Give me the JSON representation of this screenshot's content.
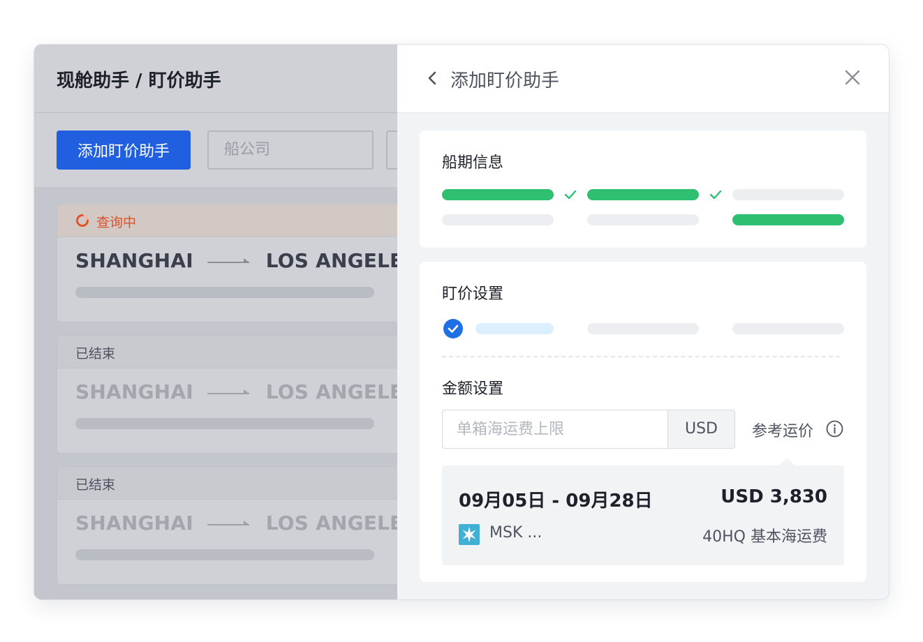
{
  "left": {
    "breadcrumb": "现舱助手 / 盯价助手",
    "add_button": "添加盯价助手",
    "carrier_placeholder": "船公司",
    "cards": [
      {
        "status": "查询中",
        "origin": "SHANGHAI",
        "destination": "LOS ANGELES",
        "active": true
      },
      {
        "status": "已结束",
        "origin": "SHANGHAI",
        "destination": "LOS ANGELES",
        "active": false
      },
      {
        "status": "已结束",
        "origin": "SHANGHAI",
        "destination": "LOS ANGELES",
        "active": false
      }
    ]
  },
  "drawer": {
    "title": "添加盯价助手",
    "schedule": {
      "title": "船期信息"
    },
    "price_settings": {
      "title": "盯价设置",
      "amount_title": "金额设置",
      "amount_placeholder": "单箱海运费上限",
      "currency": "USD",
      "reference_link": "参考运价"
    },
    "reference": {
      "date_range": "09月05日 - 09月28日",
      "price": "USD 3,830",
      "carrier": "MSK ...",
      "container_type": "40HQ 基本海运费"
    }
  },
  "colors": {
    "primary": "#1f5fe0",
    "success": "#2fbf71",
    "warning": "#d9532d",
    "check_blue": "#1f6fe5"
  }
}
